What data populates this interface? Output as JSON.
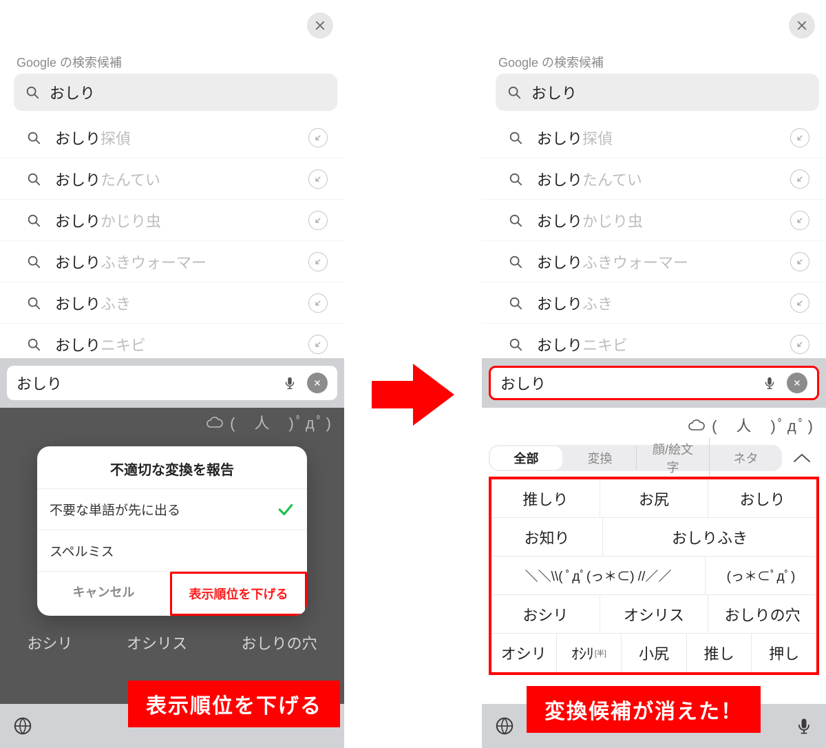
{
  "header": {
    "suggestions_title": "Google の検索候補"
  },
  "search": {
    "query": "おしり"
  },
  "suggestions": [
    {
      "prefix": "おしり",
      "suffix": "探偵"
    },
    {
      "prefix": "おしり",
      "suffix": "たんてい"
    },
    {
      "prefix": "おしり",
      "suffix": "かじり虫"
    },
    {
      "prefix": "おしり",
      "suffix": "ふきウォーマー"
    },
    {
      "prefix": "おしり",
      "suffix": "ふき"
    },
    {
      "prefix": "おしり",
      "suffix": "ニキビ"
    }
  ],
  "input": {
    "value": "おしり"
  },
  "kaomoji_preview": "(　人　)ﾟдﾟ)",
  "modal": {
    "title": "不適切な変換を報告",
    "option1": "不要な単語が先に出る",
    "option2": "スペルミス",
    "cancel": "キャンセル",
    "primary": "表示順位を下げる"
  },
  "tabs": {
    "all": "全部",
    "convert": "変換",
    "emoji": "顔/絵文字",
    "neta": "ネタ"
  },
  "candidates": {
    "row1": [
      "推しり",
      "お尻",
      "おしり"
    ],
    "row2": [
      "お知り",
      "おしりふき"
    ],
    "row3": [
      "＼＼\\\\( ﾟдﾟ(っ＊⊂) //／／",
      "(っ＊⊂ﾟдﾟ)"
    ],
    "row4": [
      "おシリ",
      "オシリス",
      "おしりの穴"
    ],
    "row5": [
      "オシリ",
      "ｵｼﾘ",
      "小尻",
      "推し",
      "押し"
    ],
    "row5_sup": "[半]"
  },
  "peek_row_left": [
    "おシリ",
    "オシリス",
    "おしりの穴"
  ],
  "annotation": {
    "left": "表示順位を下げる",
    "right": "変換候補が消えた！"
  }
}
